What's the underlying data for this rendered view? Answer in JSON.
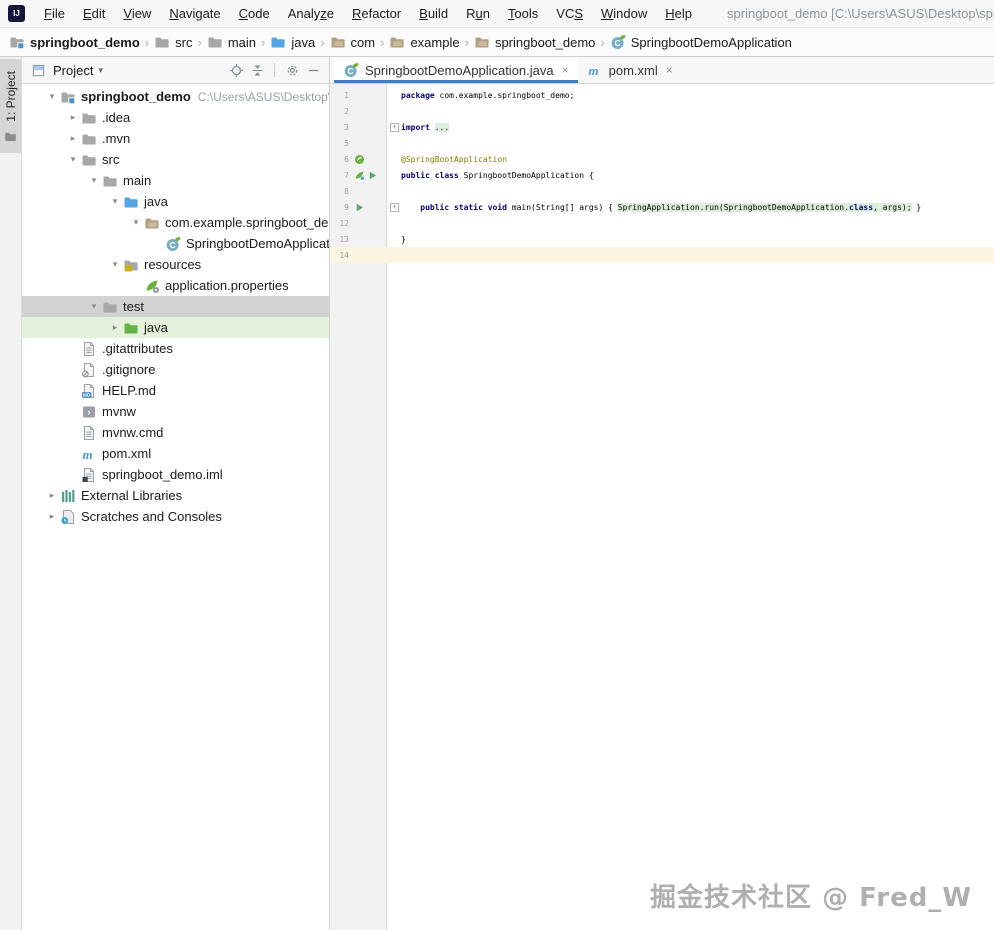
{
  "window": {
    "logo_text": "IJ",
    "title": "springboot_demo [C:\\Users\\ASUS\\Desktop\\springboot_demo]"
  },
  "menu_bar": {
    "items": [
      {
        "label": "File",
        "mnemonic": "F"
      },
      {
        "label": "Edit",
        "mnemonic": "E"
      },
      {
        "label": "View",
        "mnemonic": "V"
      },
      {
        "label": "Navigate",
        "mnemonic": "N"
      },
      {
        "label": "Code",
        "mnemonic": "C"
      },
      {
        "label": "Analyze",
        "mnemonic": "z"
      },
      {
        "label": "Refactor",
        "mnemonic": "R"
      },
      {
        "label": "Build",
        "mnemonic": "B"
      },
      {
        "label": "Run",
        "mnemonic": "u"
      },
      {
        "label": "Tools",
        "mnemonic": "T"
      },
      {
        "label": "VCS",
        "mnemonic": "S"
      },
      {
        "label": "Window",
        "mnemonic": "W"
      },
      {
        "label": "Help",
        "mnemonic": "H"
      }
    ]
  },
  "breadcrumbs": [
    {
      "label": "springboot_demo",
      "icon": "module",
      "bold": true
    },
    {
      "label": "src",
      "icon": "folder"
    },
    {
      "label": "main",
      "icon": "folder"
    },
    {
      "label": "java",
      "icon": "folder-src"
    },
    {
      "label": "com",
      "icon": "package"
    },
    {
      "label": "example",
      "icon": "package"
    },
    {
      "label": "springboot_demo",
      "icon": "package"
    },
    {
      "label": "SpringbootDemoApplication",
      "icon": "class"
    }
  ],
  "tool_window_bar": {
    "project_button_label": "1: Project"
  },
  "project_panel": {
    "title": "Project",
    "tree": [
      {
        "label": "springboot_demo",
        "suffix": "C:\\Users\\ASUS\\Desktop\\springboot_demo",
        "icon": "module",
        "level": 0,
        "chevron": "open",
        "bold": true
      },
      {
        "label": ".idea",
        "icon": "folder",
        "level": 1,
        "chevron": "closed"
      },
      {
        "label": ".mvn",
        "icon": "folder",
        "level": 1,
        "chevron": "closed"
      },
      {
        "label": "src",
        "icon": "folder",
        "level": 1,
        "chevron": "open"
      },
      {
        "label": "main",
        "icon": "folder",
        "level": 2,
        "chevron": "open"
      },
      {
        "label": "java",
        "icon": "folder-src",
        "level": 3,
        "chevron": "open"
      },
      {
        "label": "com.example.springboot_demo",
        "icon": "package",
        "level": 4,
        "chevron": "open"
      },
      {
        "label": "SpringbootDemoApplication",
        "icon": "class",
        "level": 5
      },
      {
        "label": "resources",
        "icon": "folder-resources",
        "level": 3,
        "chevron": "open"
      },
      {
        "label": "application.properties",
        "icon": "spring-config",
        "level": 4
      },
      {
        "label": "test",
        "icon": "folder",
        "level": 2,
        "chevron": "open",
        "selected": "gray"
      },
      {
        "label": "java",
        "icon": "folder-test",
        "level": 3,
        "chevron": "closed",
        "selected": "green"
      },
      {
        "label": ".gitattributes",
        "icon": "file-text",
        "level": 1
      },
      {
        "label": ".gitignore",
        "icon": "file-ignored",
        "level": 1
      },
      {
        "label": "HELP.md",
        "icon": "file-md",
        "level": 1
      },
      {
        "label": "mvnw",
        "icon": "file-shell",
        "level": 1
      },
      {
        "label": "mvnw.cmd",
        "icon": "file-text",
        "level": 1
      },
      {
        "label": "pom.xml",
        "icon": "maven",
        "level": 1
      },
      {
        "label": "springboot_demo.iml",
        "icon": "file-iml",
        "level": 1
      },
      {
        "label": "External Libraries",
        "icon": "libraries",
        "level": 0,
        "chevron": "closed"
      },
      {
        "label": "Scratches and Consoles",
        "icon": "scratches",
        "level": 0,
        "chevron": "closed"
      }
    ]
  },
  "editor": {
    "tabs": [
      {
        "label": "SpringbootDemoApplication.java",
        "icon": "class",
        "active": true
      },
      {
        "label": "pom.xml",
        "icon": "maven",
        "active": false
      }
    ],
    "lines": [
      {
        "num": "1",
        "segments": [
          {
            "t": "package ",
            "s": "kw"
          },
          {
            "t": "com.example.springboot_demo;",
            "s": "pl"
          }
        ]
      },
      {
        "num": "2",
        "segments": []
      },
      {
        "num": "3",
        "fold": true,
        "segments": [
          {
            "t": "import ",
            "s": "kw"
          },
          {
            "t": "...",
            "s": "fd"
          }
        ]
      },
      {
        "num": "5",
        "segments": []
      },
      {
        "num": "6",
        "gutter": [
          "boot"
        ],
        "segments": [
          {
            "t": "@SpringBootApplication",
            "s": "ann"
          }
        ]
      },
      {
        "num": "7",
        "gutter": [
          "springleaf",
          "run"
        ],
        "segments": [
          {
            "t": "public class ",
            "s": "kw"
          },
          {
            "t": "SpringbootDemoApplication {",
            "s": "pl"
          }
        ]
      },
      {
        "num": "8",
        "segments": []
      },
      {
        "num": "9",
        "gutter": [
          "run"
        ],
        "fold": true,
        "segments": [
          {
            "t": "    ",
            "s": "pl"
          },
          {
            "t": "public static void ",
            "s": "kw"
          },
          {
            "t": "main(String[] args) ",
            "s": "pl"
          },
          {
            "t": "{ ",
            "s": "pl"
          },
          {
            "t": "SpringApplication.run(SpringbootDemoApplication.",
            "s": "fd"
          },
          {
            "t": "class",
            "s": "fdkw"
          },
          {
            "t": ", args);",
            "s": "fd"
          },
          {
            "t": " }",
            "s": "pl"
          }
        ]
      },
      {
        "num": "12",
        "segments": []
      },
      {
        "num": "13",
        "segments": [
          {
            "t": "}",
            "s": "pl"
          }
        ]
      },
      {
        "num": "14",
        "caret": true,
        "segments": []
      }
    ]
  },
  "watermark": "掘金技术社区 @ Fred_W",
  "colors": {
    "accent_blue": "#3D7DC2",
    "selection_gray": "#D2D2D2",
    "selection_green": "#E4F2DB",
    "caret_line": "#FBF5E1",
    "keyword": "#000080",
    "annotation": "#808000",
    "spring_green": "#6DB33F"
  }
}
